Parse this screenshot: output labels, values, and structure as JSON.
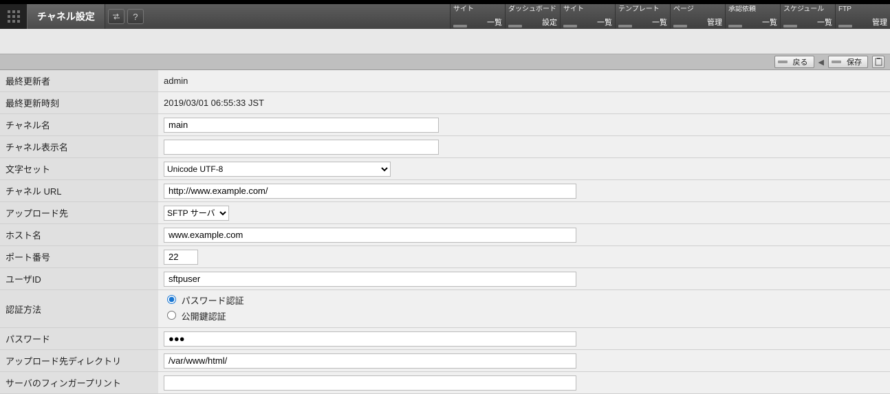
{
  "header": {
    "title": "チャネル設定"
  },
  "menu": [
    {
      "top": "サイト",
      "bot": "一覧"
    },
    {
      "top": "ダッシュボード",
      "bot": "設定"
    },
    {
      "top": "サイト",
      "bot": "一覧"
    },
    {
      "top": "テンプレート",
      "bot": "一覧"
    },
    {
      "top": "ページ",
      "bot": "管理"
    },
    {
      "top": "承認依頼",
      "bot": "一覧"
    },
    {
      "top": "スケジュール",
      "bot": "一覧"
    },
    {
      "top": "FTP",
      "bot": "管理"
    }
  ],
  "actions": {
    "back": "戻る",
    "save": "保存"
  },
  "labels": {
    "last_updater": "最終更新者",
    "last_updated": "最終更新時刻",
    "channel_name": "チャネル名",
    "channel_display": "チャネル表示名",
    "charset": "文字セット",
    "channel_url": "チャネル URL",
    "upload_dest": "アップロード先",
    "hostname": "ホスト名",
    "port": "ポート番号",
    "user_id": "ユーザID",
    "auth_method": "認証方法",
    "password": "パスワード",
    "upload_dir": "アップロード先ディレクトリ",
    "fingerprint": "サーバのフィンガープリント"
  },
  "values": {
    "last_updater": "admin",
    "last_updated": "2019/03/01 06:55:33 JST",
    "channel_name": "main",
    "channel_display": "",
    "charset": "Unicode UTF-8",
    "channel_url": "http://www.example.com/",
    "upload_dest": "SFTP サーバ",
    "hostname": "www.example.com",
    "port": "22",
    "user_id": "sftpuser",
    "auth_password_label": "パスワード認証",
    "auth_pubkey_label": "公開鍵認証",
    "password": "●●●",
    "upload_dir": "/var/www/html/",
    "fingerprint": ""
  }
}
